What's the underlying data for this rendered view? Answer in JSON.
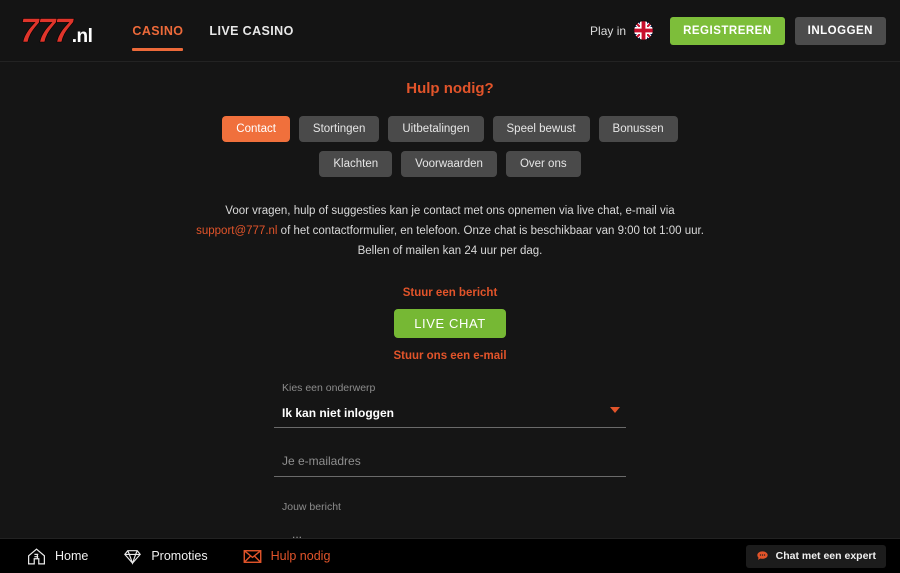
{
  "header": {
    "logo": {
      "main": "777",
      "suffix": ".nl"
    },
    "nav": [
      {
        "label": "CASINO",
        "active": true,
        "name": "nav-casino"
      },
      {
        "label": "LIVE CASINO",
        "active": false,
        "name": "nav-live-casino"
      }
    ],
    "play_in_label": "Play in",
    "flag_icon": "uk-flag-icon",
    "register_label": "REGISTREREN",
    "login_label": "INLOGGEN"
  },
  "main": {
    "title": "Hulp nodig?",
    "tabs_row1": [
      {
        "label": "Contact",
        "active": true
      },
      {
        "label": "Stortingen",
        "active": false
      },
      {
        "label": "Uitbetalingen",
        "active": false
      },
      {
        "label": "Speel bewust",
        "active": false
      },
      {
        "label": "Bonussen",
        "active": false
      }
    ],
    "tabs_row2": [
      {
        "label": "Klachten",
        "active": false
      },
      {
        "label": "Voorwaarden",
        "active": false
      },
      {
        "label": "Over ons",
        "active": false
      }
    ],
    "intro_part1": "Voor vragen, hulp of suggesties kan je contact met ons opnemen via live chat, e-mail via ",
    "intro_email": "support@777.nl",
    "intro_part2": " of het contactformulier, en telefoon. Onze chat is beschikbaar van 9:00 tot 1:00 uur. Bellen of mailen kan 24 uur per dag.",
    "send_message_label": "Stuur een bericht",
    "live_chat_button": "LIVE CHAT",
    "send_email_link": "Stuur ons een e-mail"
  },
  "form": {
    "subject_label": "Kies een onderwerp",
    "subject_value": "Ik kan niet inloggen",
    "email_placeholder": "Je e-mailadres",
    "email_value": "",
    "message_label": "Jouw bericht",
    "message_placeholder": "..."
  },
  "bottom_bar": {
    "items": [
      {
        "label": "Home",
        "icon": "home-icon",
        "active": false
      },
      {
        "label": "Promoties",
        "icon": "diamond-icon",
        "active": false
      },
      {
        "label": "Hulp nodig",
        "icon": "envelope-icon",
        "active": true
      }
    ],
    "chat_widget_label": "Chat met een expert",
    "chat_widget_icon": "chat-bubble-icon"
  },
  "colors": {
    "accent_orange": "#ED6A3A",
    "link_orange": "#E2542A",
    "green": "#76B834",
    "register_green": "#7DBE3A",
    "logo_red": "#E0352B",
    "bg": "#151515",
    "tab_gray": "#4A4A4A"
  }
}
